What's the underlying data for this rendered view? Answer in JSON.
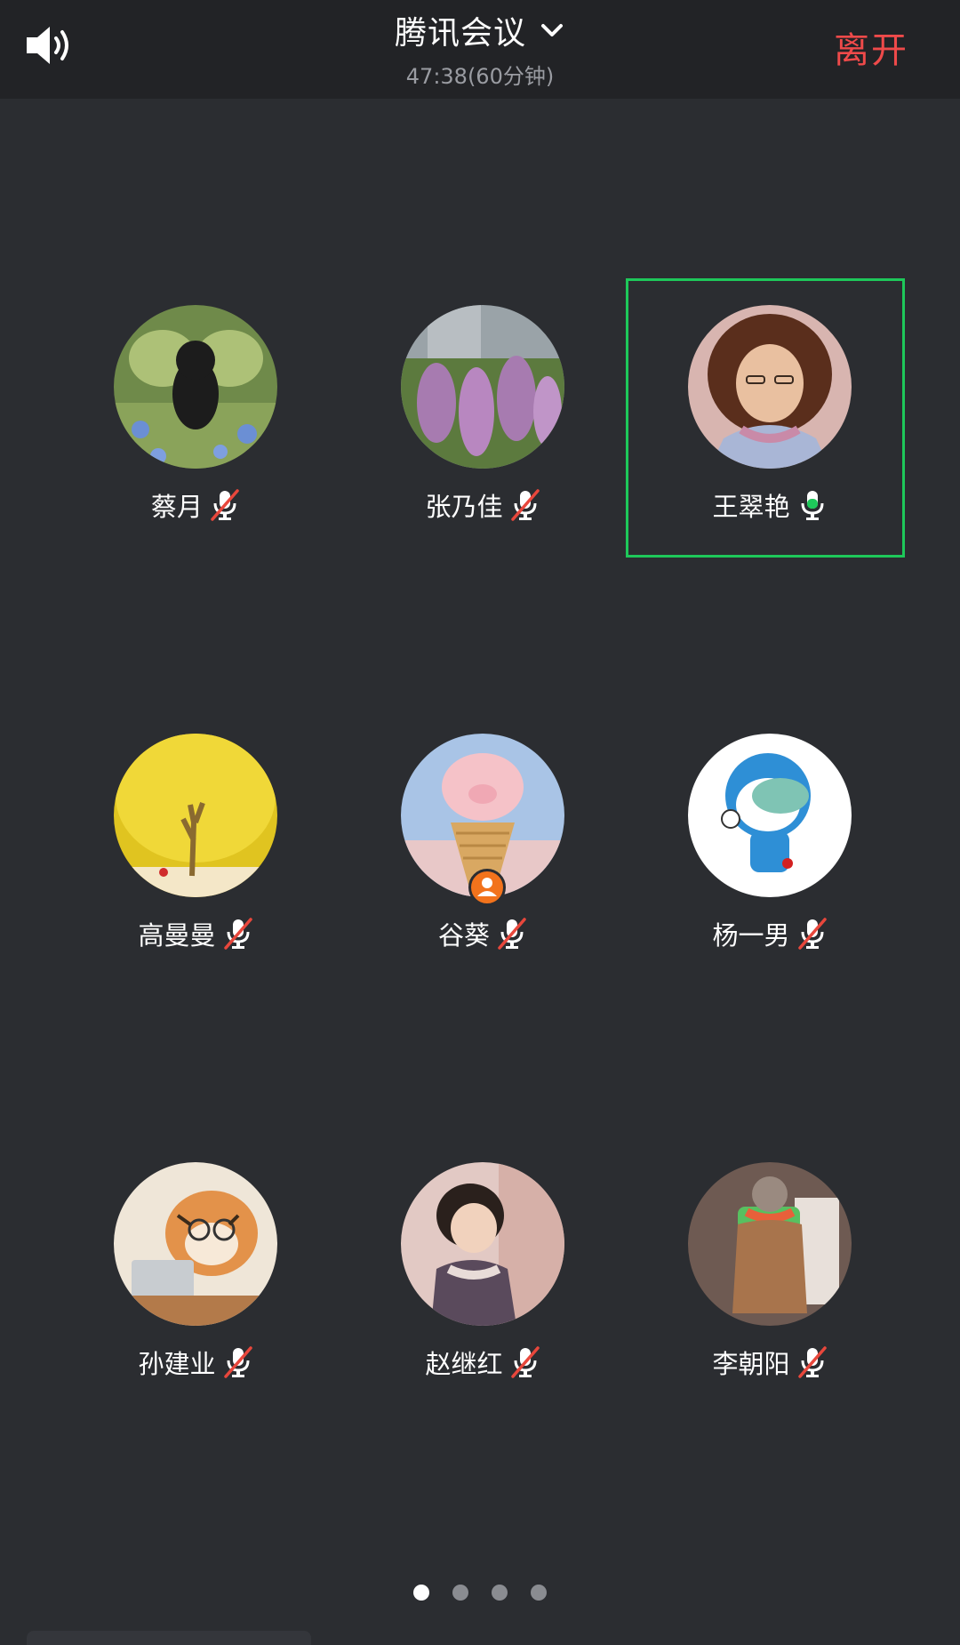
{
  "header": {
    "title": "腾讯会议",
    "duration": "47:38(60分钟)",
    "leave_label": "离开",
    "speaker_icon": "speaker-icon",
    "dropdown_icon": "chevron-down-icon"
  },
  "colors": {
    "background": "#2b2d31",
    "topbar": "#222326",
    "leave": "#ef4a4a",
    "active_speaker": "#1ec85a",
    "muted_slash": "#e8473c",
    "host_badge": "#f2731c"
  },
  "participants": [
    {
      "name": "蔡月",
      "mic": "muted"
    },
    {
      "name": "张乃佳",
      "mic": "muted"
    },
    {
      "name": "王翠艳",
      "mic": "speaking",
      "active": true
    },
    {
      "name": "高曼曼",
      "mic": "muted"
    },
    {
      "name": "谷葵",
      "mic": "muted",
      "host": true
    },
    {
      "name": "杨一男",
      "mic": "muted"
    },
    {
      "name": "孙建业",
      "mic": "muted"
    },
    {
      "name": "赵继红",
      "mic": "muted"
    },
    {
      "name": "李朝阳",
      "mic": "muted"
    }
  ],
  "pager": {
    "total_pages": 4,
    "current_page": 1
  }
}
